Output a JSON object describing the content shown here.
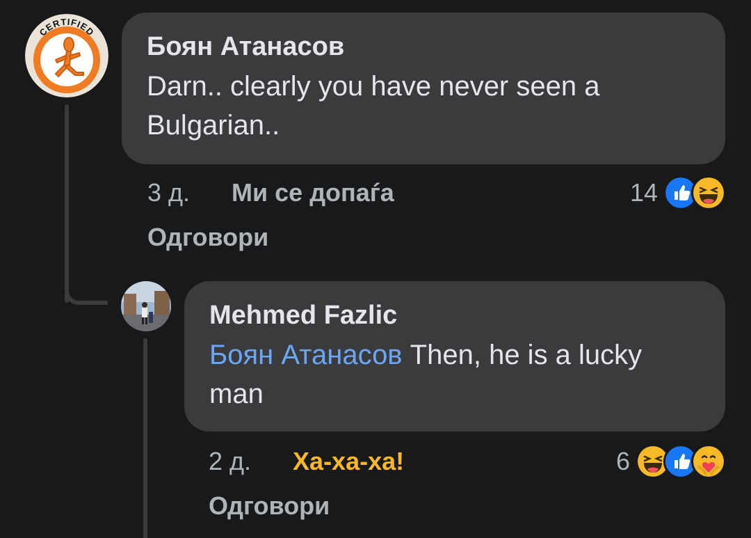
{
  "comment": {
    "author": "Боян Атанасов",
    "text": "Darn..  clearly you have never seen a Bulgarian..",
    "time": "3 д.",
    "like_label": "Ми се допаѓа",
    "reply_label": "Одговори",
    "reaction_count": "14",
    "reactions": [
      "like-icon",
      "haha-icon"
    ],
    "avatar_badge_text": "CERTIFIED"
  },
  "reply": {
    "author": "Mehmed Fazlic",
    "mention": "Боян Атанасов",
    "text": " Then, he is a lucky man",
    "time": "2 д.",
    "haha_label": "Ха-ха-ха!",
    "reply_label": "Одговори",
    "reaction_count": "6",
    "reactions": [
      "haha-icon",
      "like-icon",
      "care-icon"
    ]
  },
  "colors": {
    "background": "#18191a",
    "bubble": "#3a3b3c",
    "primary_text": "#e4e6eb",
    "secondary_text": "#b0b3b8",
    "mention": "#6ea6f5",
    "haha_accent": "#f7b928",
    "like_blue": "#1877f2",
    "avatar_orange": "#ef7c23"
  }
}
